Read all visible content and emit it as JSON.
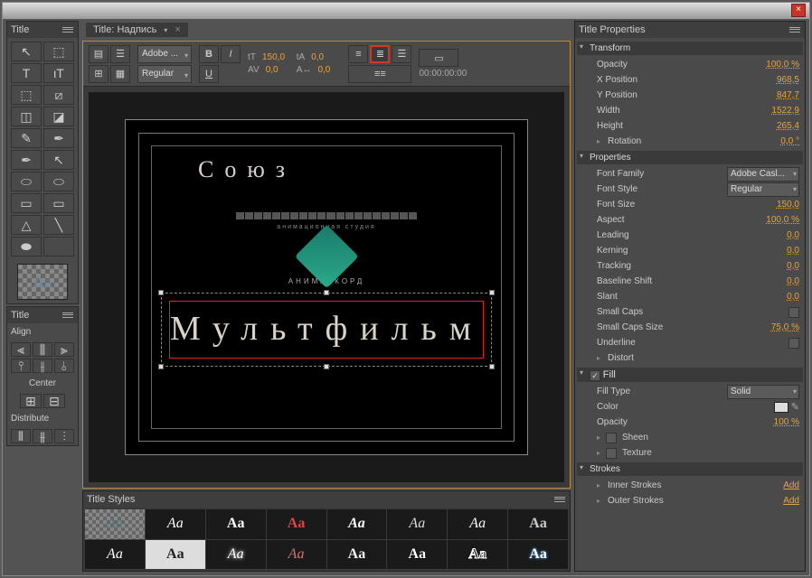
{
  "window": {
    "close": "×"
  },
  "left": {
    "title_tab": "Title",
    "tools": [
      "↖",
      "⬚",
      "T",
      "ιT",
      "⬚",
      "⧄",
      "◫",
      "◪",
      "✎",
      "✒",
      "✒",
      "↖",
      "⬭",
      "⬭",
      "▭",
      "▭",
      "△",
      "╲",
      "⬬"
    ],
    "swatch": "Aa",
    "align_tab": "Title",
    "align_label": "Align",
    "center_label": "Center",
    "distribute_label": "Distribute"
  },
  "doc": {
    "tab": "Title: Надпись",
    "font_family": "Adobe ...",
    "font_style": "Regular",
    "bold": "B",
    "italic": "I",
    "underline": "U",
    "size": "150,0",
    "av": "0,0",
    "aspect": "0,0",
    "leading": "0,0",
    "timecode": "00:00:00:00"
  },
  "canvas": {
    "text1": "Союз",
    "studio_top": "анимационная студия",
    "studio_bottom": "АНИМАККОРД",
    "text2": "Мультфильм"
  },
  "styles": {
    "tab": "Title Styles",
    "sample": "Aa"
  },
  "props": {
    "tab": "Title Properties",
    "transform": "Transform",
    "opacity_l": "Opacity",
    "opacity_v": "100,0 %",
    "xpos_l": "X Position",
    "xpos_v": "968,5",
    "ypos_l": "Y Position",
    "ypos_v": "847,7",
    "width_l": "Width",
    "width_v": "1522,9",
    "height_l": "Height",
    "height_v": "265,4",
    "rotation_l": "Rotation",
    "rotation_v": "0,0 °",
    "properties": "Properties",
    "ff_l": "Font Family",
    "ff_v": "Adobe Casl...",
    "fs_l": "Font Style",
    "fs_v": "Regular",
    "fsize_l": "Font Size",
    "fsize_v": "150,0",
    "aspect_l": "Aspect",
    "aspect_v": "100,0 %",
    "leading_l": "Leading",
    "leading_v": "0,0",
    "kerning_l": "Kerning",
    "kerning_v": "0,0",
    "tracking_l": "Tracking",
    "tracking_v": "0,0",
    "baseline_l": "Baseline Shift",
    "baseline_v": "0,0",
    "slant_l": "Slant",
    "slant_v": "0,0",
    "smallcaps_l": "Small Caps",
    "smallcapssize_l": "Small Caps Size",
    "smallcapssize_v": "75,0 %",
    "underline_l": "Underline",
    "distort_l": "Distort",
    "fill": "Fill",
    "filltype_l": "Fill Type",
    "filltype_v": "Solid",
    "color_l": "Color",
    "fopacity_l": "Opacity",
    "fopacity_v": "100 %",
    "sheen_l": "Sheen",
    "texture_l": "Texture",
    "strokes": "Strokes",
    "inner_l": "Inner Strokes",
    "add": "Add",
    "outer_l": "Outer Strokes"
  }
}
